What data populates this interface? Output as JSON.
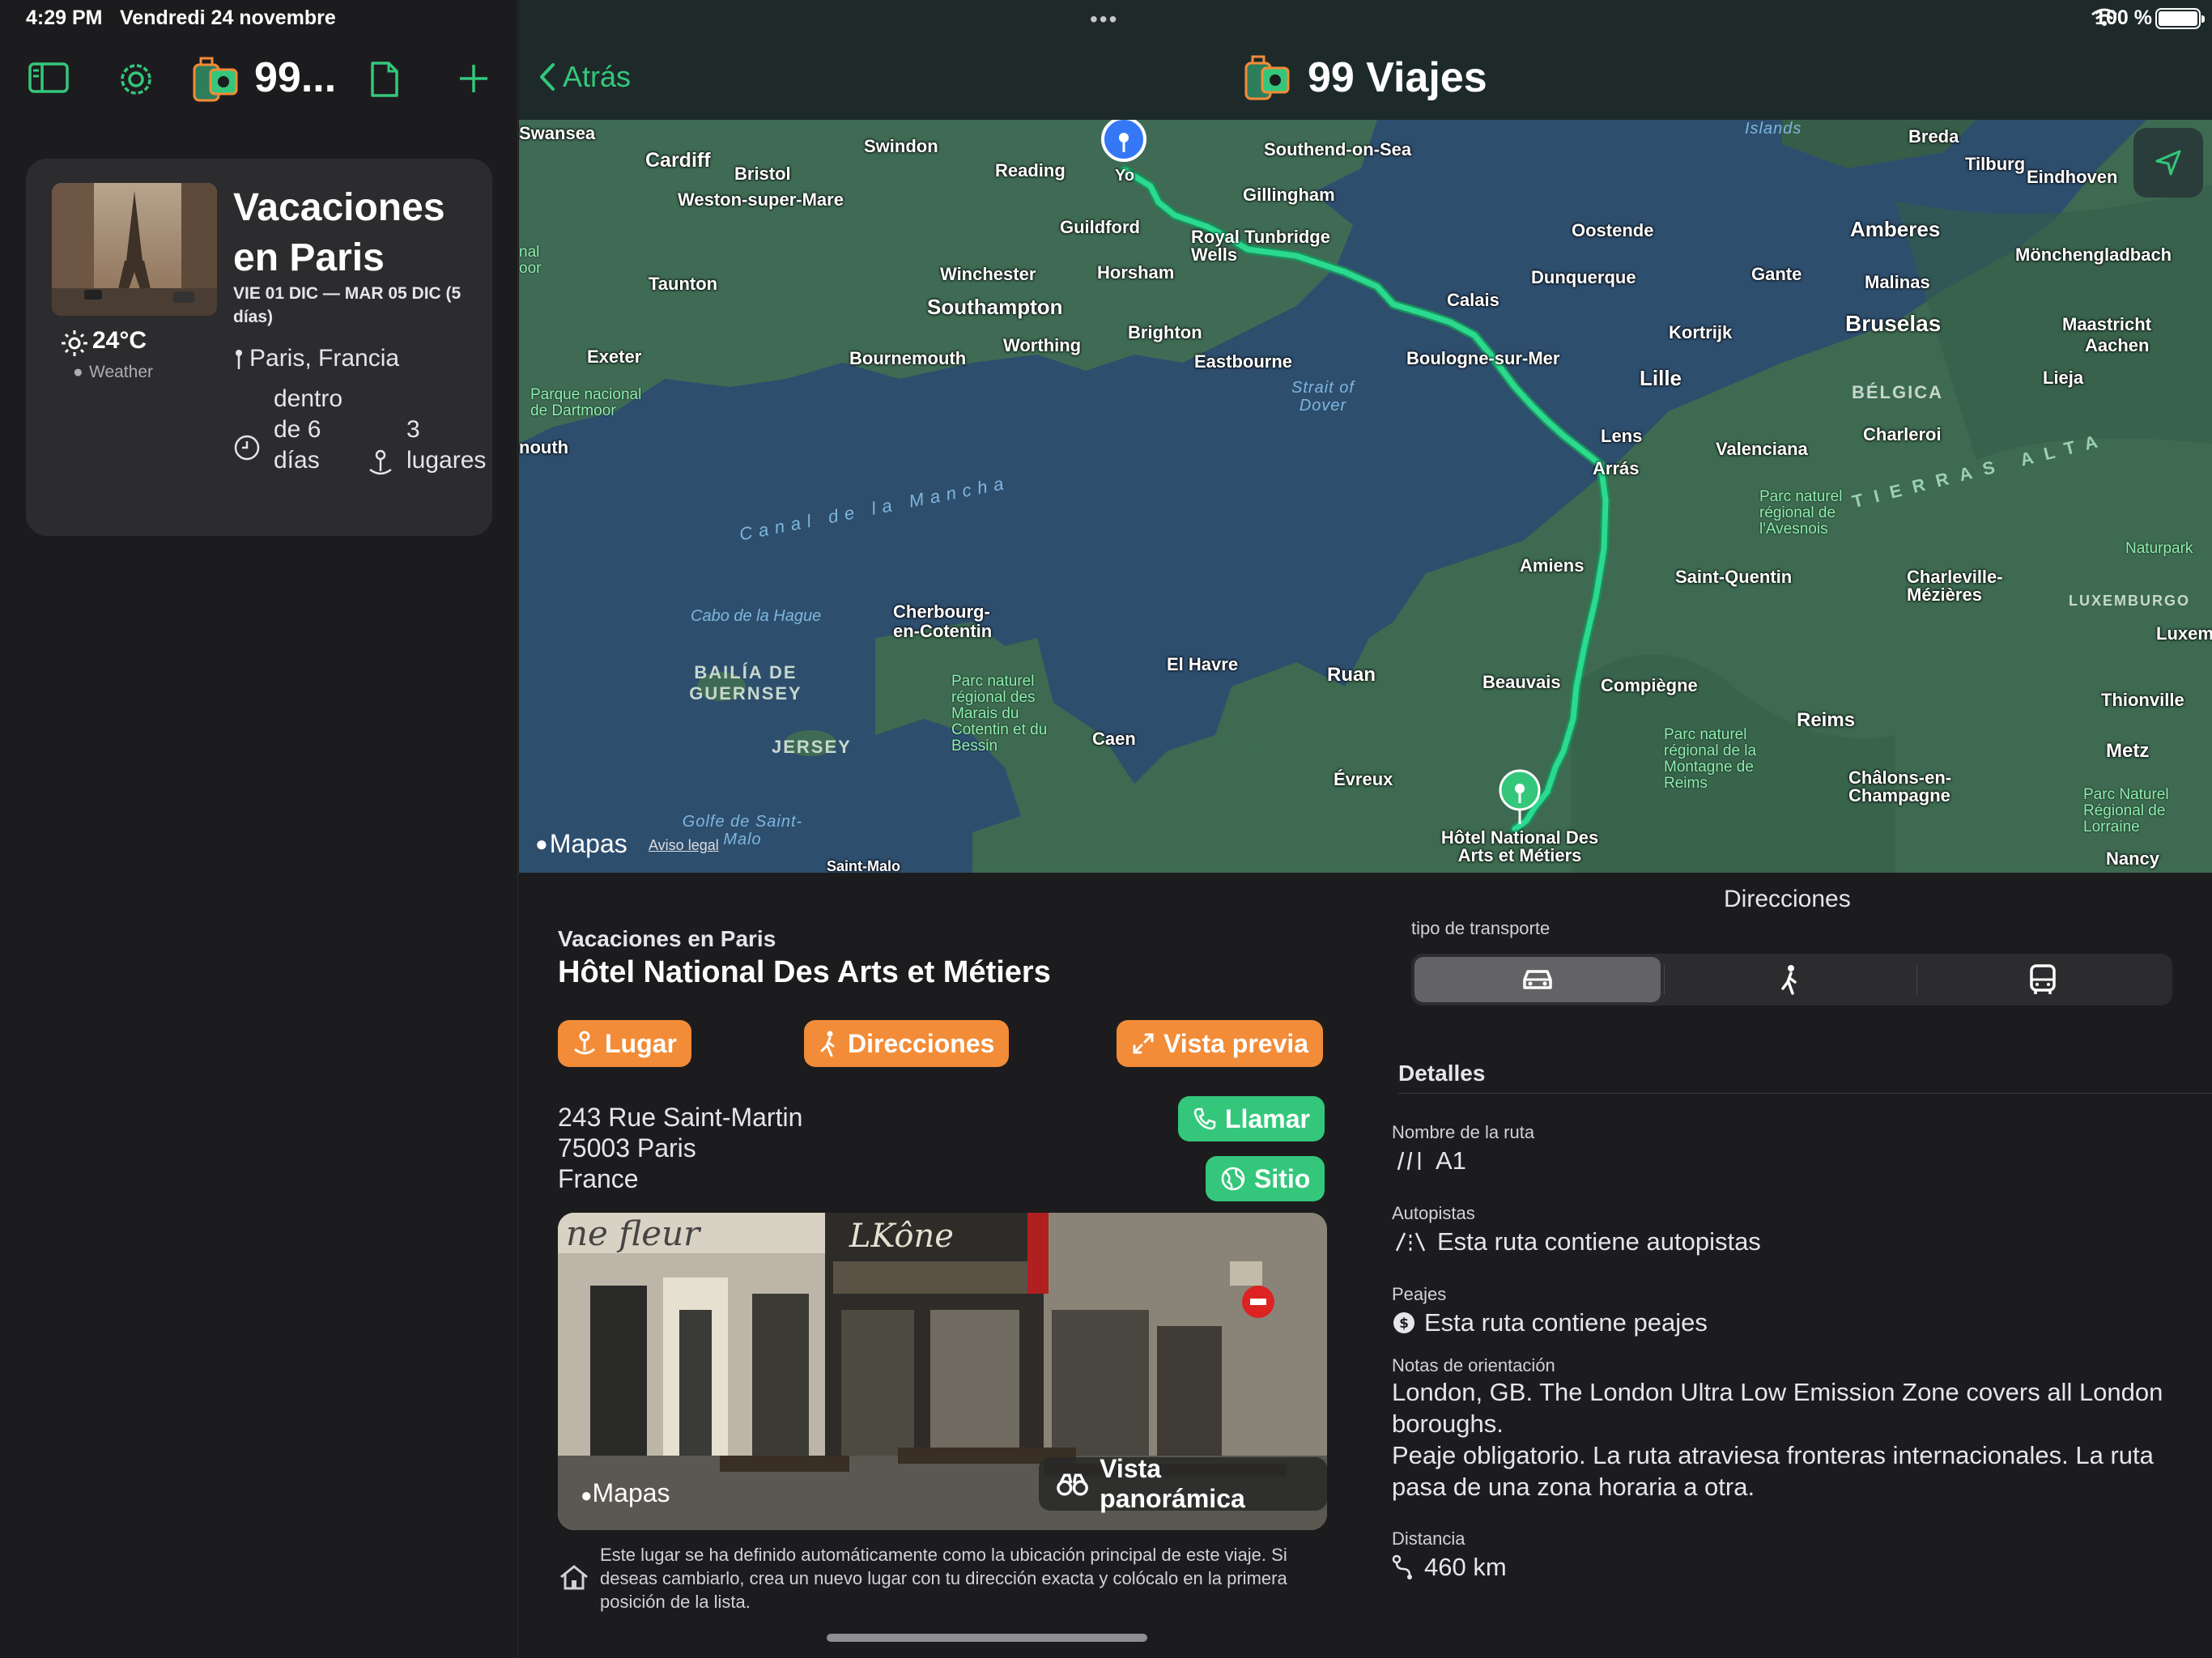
{
  "status_bar": {
    "time": "4:29 PM",
    "date": "Vendredi 24 novembre",
    "battery": "100 %"
  },
  "sidebar": {
    "app_title": "99...",
    "trip": {
      "title": "Vacaciones en Paris",
      "dates": "VIE 01 DIC — MAR 05 DIC (5 días)",
      "temperature": "24°C",
      "weather_source": "Weather",
      "location": "Paris, Francia",
      "duration": "dentro de 6 días",
      "places": "3 lugares"
    }
  },
  "nav": {
    "back_label": "Atrás",
    "title": "99 Viajes",
    "more": "•••"
  },
  "map": {
    "watermark": "Mapas",
    "legal": "Aviso legal",
    "pin_start_label": "Yo",
    "pin_end_label": "Hôtel National Des Arts et Métiers",
    "cities": [
      "Swansea",
      "Cardiff",
      "Bristol",
      "Swindon",
      "Weston-super-Mare",
      "Reading",
      "Guildford",
      "Gillingham",
      "Southend-on-Sea",
      "Royal Tunbridge Wells",
      "Horsham",
      "Winchester",
      "Southampton",
      "Taunton",
      "Bournemouth",
      "Worthing",
      "Brighton",
      "Eastbourne",
      "Exeter",
      "Calais",
      "Dunquerque",
      "Oostende",
      "Breda",
      "Tilburg",
      "Eindhoven",
      "Amberes",
      "Gante",
      "Malinas",
      "Mönchengladbach",
      "Bruselas",
      "Kortrijk",
      "Boulogne-sur-Mer",
      "Lille",
      "Maastricht",
      "Aachen",
      "Lieja",
      "Lens",
      "Arrás",
      "Valenciana",
      "Charleroi",
      "Amiens",
      "Saint-Quentin",
      "Charleville-Mézières",
      "Cherbourg-en-Cotentin",
      "El Havre",
      "Ruan",
      "Beauvais",
      "Compiègne",
      "Reims",
      "Caen",
      "Évreux",
      "Châlons-en-Champagne",
      "Metz",
      "Nancy",
      "Thionville",
      "Luxemb",
      "Saint-Malo",
      "nouth"
    ],
    "water": [
      "Canal de la Mancha",
      "Strait of Dover",
      "Cabo de la Hague",
      "Golfe de Saint-Malo",
      "Islands"
    ],
    "regions": [
      "BAILÍA DE GUERNSEY",
      "JERSEY",
      "BÉLGICA",
      "LUXEMBURGO",
      "TIERRAS ALTA"
    ],
    "parks": [
      "Parque nacional de Dartmoor",
      "Parc naturel régional des Marais du Cotentin et du Bessin",
      "Parc naturel régional de l'Avesnois",
      "Parc naturel régional de la Montagne de Reims",
      "Parc Naturel Régional de Lorraine",
      "Naturpark",
      "nal oor"
    ]
  },
  "detail": {
    "trip_name": "Vacaciones en Paris",
    "place_name": "Hôtel National Des Arts et Métiers",
    "buttons": {
      "place": "Lugar",
      "directions": "Direcciones",
      "preview": "Vista previa",
      "call": "Llamar",
      "site": "Sitio"
    },
    "address": [
      "243 Rue Saint-Martin",
      "75003 Paris",
      "France"
    ],
    "photo_watermark": "Mapas",
    "panorama": "Vista panorámica",
    "footnote": "Este lugar se ha definido automáticamente como la ubicación principal de este viaje. Si deseas cambiarlo, crea un nuevo lugar con tu dirección exacta y colócalo en la primera posición de la lista."
  },
  "directions": {
    "title": "Direcciones",
    "transport_label": "tipo de transporte",
    "details_heading": "Detalles",
    "route_name_label": "Nombre de la ruta",
    "route_name": "A1",
    "highways_label": "Autopistas",
    "highways_value": "Esta ruta contiene autopistas",
    "tolls_label": "Peajes",
    "tolls_value": "Esta ruta contiene peajes",
    "notes_label": "Notas de orientación",
    "notes": "London, GB. The London Ultra Low Emission Zone covers all London boroughs.\nPeaje obligatorio. La ruta atraviesa fronteras internacionales. La ruta pasa de una zona horaria a otra.",
    "distance_label": "Distancia",
    "distance_value": "460 km"
  },
  "colors": {
    "accent_green": "#34c77b",
    "accent_orange": "#f28c38",
    "background": "#1c1c1e",
    "card": "#2c2c2e",
    "route": "#2bd98f"
  }
}
